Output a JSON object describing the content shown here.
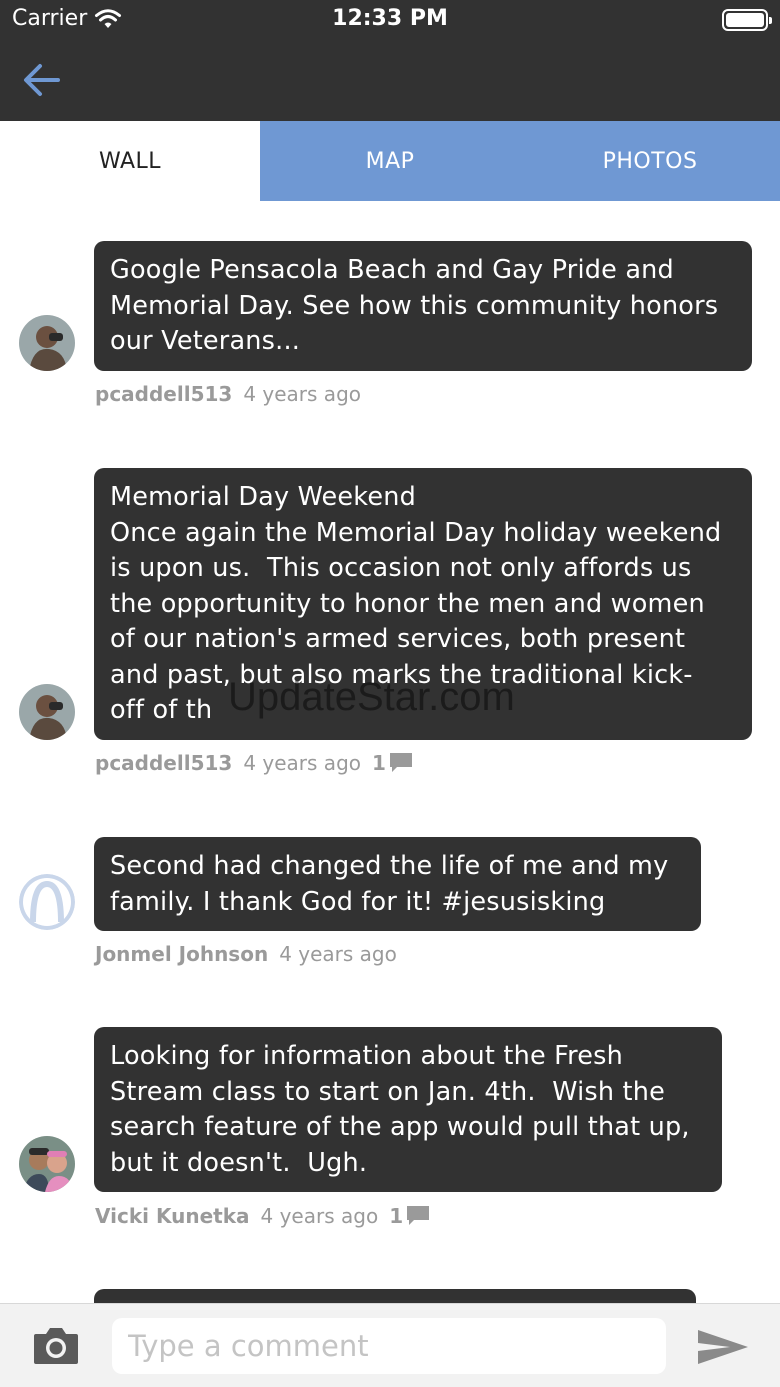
{
  "status_bar": {
    "carrier": "Carrier",
    "time": "12:33 PM"
  },
  "tabs": [
    {
      "label": "WALL",
      "active": true
    },
    {
      "label": "MAP",
      "active": false
    },
    {
      "label": "PHOTOS",
      "active": false
    }
  ],
  "posts": [
    {
      "text": "Google Pensacola Beach and Gay Pride and\nMemorial Day. See how this community honors\nour Veterans...",
      "author": "pcaddell513",
      "time": "4 years ago",
      "comments": ""
    },
    {
      "text": "Memorial Day Weekend\nOnce again the Memorial Day holiday weekend\nis upon us.  This occasion not only affords us\nthe opportunity to honor the men and women\nof our nation's armed services, both present\nand past, but also marks the traditional kick-\noff of th",
      "author": "pcaddell513",
      "time": "4 years ago",
      "comments": "1"
    },
    {
      "text": "Second had changed the life of me and my\nfamily. I thank God for it! #jesusisking",
      "author": "Jonmel Johnson",
      "time": "4 years ago",
      "comments": ""
    },
    {
      "text": "Looking for information about the Fresh\nStream class to start on Jan. 4th.  Wish the\nsearch feature of the app would pull that up,\nbut it doesn't.  Ugh.",
      "author": "Vicki Kunetka",
      "time": "4 years ago",
      "comments": "1"
    }
  ],
  "watermark": "UpdateStar.com",
  "composer": {
    "placeholder": "Type a comment"
  },
  "colors": {
    "bar": "#323232",
    "tab_inactive": "#6f98d3",
    "back_arrow": "#6f98d3",
    "bubble": "#323232",
    "meta_text": "#9a9a9a"
  },
  "icons": {
    "back": "back-arrow-icon",
    "wifi": "wifi-icon",
    "battery": "battery-icon",
    "comment": "comment-bubble-icon",
    "camera": "camera-icon",
    "send": "send-icon",
    "default_avatar": "default-avatar-icon"
  }
}
